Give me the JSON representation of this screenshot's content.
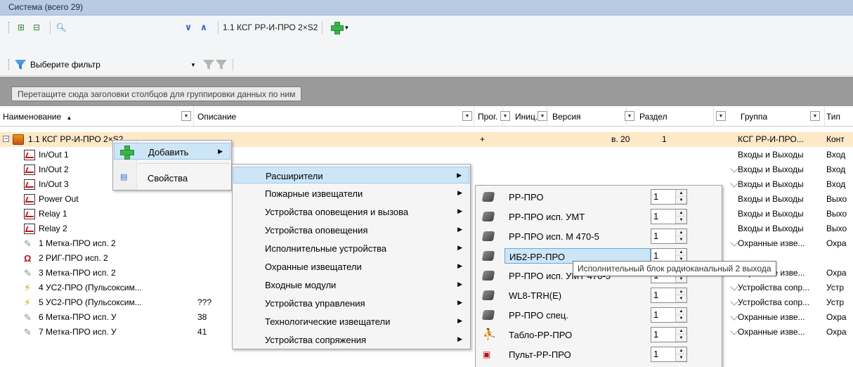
{
  "title": "Система (всего 29)",
  "toolbar": {
    "current_device": "1.1 КСГ РР-И-ПРО 2×S2"
  },
  "filter": {
    "label": "Выберите фильтр"
  },
  "group_hint": "Перетащите сюда заголовки столбцов для группировки данных по ним",
  "columns": {
    "name": "Наименование",
    "sort": "▲",
    "description": "Описание",
    "prog": "Прог.",
    "init": "Иниц.",
    "version": "Версия",
    "section": "Раздел",
    "group": "Группа",
    "type": "Тип"
  },
  "rows": [
    {
      "name": "1.1 КСГ РР-И-ПРО 2×S2",
      "desc": "",
      "prog": "+",
      "version": "в. 20",
      "section": "1",
      "group": "КСГ РР-И-ПРО...",
      "type": "Конт",
      "icon": "device-icon",
      "selected": true
    },
    {
      "name": "In/Out 1",
      "desc": "",
      "group": "Входы и Выходы",
      "type": "Вход",
      "icon": "io-icon"
    },
    {
      "name": "In/Out 2",
      "desc": "",
      "group": "Входы и Выходы",
      "type": "Вход",
      "icon": "io-icon"
    },
    {
      "name": "In/Out 3",
      "desc": "",
      "group": "Входы и Выходы",
      "type": "Вход",
      "icon": "io-icon"
    },
    {
      "name": "Power Out",
      "desc": "",
      "group": "Входы и Выходы",
      "type": "Выхо",
      "icon": "io-icon"
    },
    {
      "name": "Relay 1",
      "desc": "",
      "group": "Входы и Выходы",
      "type": "Выхо",
      "icon": "io-icon"
    },
    {
      "name": "Relay 2",
      "desc": "",
      "group": "Входы и Выходы",
      "type": "Выхо",
      "icon": "io-icon"
    },
    {
      "name": "1 Метка-ПРО исп. 2",
      "desc": "",
      "group": "Охранные изве...",
      "type": "Охра",
      "icon": "tag-icon"
    },
    {
      "name": "2 РИГ-ПРО исп. 2",
      "desc": "",
      "group": "",
      "type": "",
      "icon": "magnet-icon"
    },
    {
      "name": "3 Метка-ПРО исп. 2",
      "desc": "",
      "group": "Охранные изве...",
      "type": "Охра",
      "icon": "tag-icon"
    },
    {
      "name": "4 УС2-ПРО (Пульсоксим...",
      "desc": "",
      "group": "Устройства сопр...",
      "type": "Устр",
      "icon": "bolt-icon"
    },
    {
      "name": "5 УС2-ПРО (Пульсоксим...",
      "desc": "???",
      "group": "Устройства сопр...",
      "type": "Устр",
      "icon": "bolt-icon"
    },
    {
      "name": "6 Метка-ПРО исп. У",
      "desc": "38",
      "group": "Охранные изве...",
      "type": "Охра",
      "icon": "tag-icon"
    },
    {
      "name": "7 Метка-ПРО исп. У",
      "desc": "41",
      "group": "Охранные изве...",
      "type": "Охра",
      "icon": "tag-icon"
    }
  ],
  "context_menu": {
    "items": [
      {
        "label": "Добавить",
        "icon": "plus-icon",
        "has_submenu": true,
        "highlighted": true
      },
      {
        "label": "Свойства",
        "icon": "properties-icon",
        "has_submenu": false
      }
    ]
  },
  "submenu": {
    "items": [
      {
        "label": "Расширители",
        "highlighted": true
      },
      {
        "label": "Пожарные извещатели"
      },
      {
        "label": "Устройства оповещения и вызова"
      },
      {
        "label": "Устройства оповещения"
      },
      {
        "label": "Исполнительные устройства"
      },
      {
        "label": "Охранные извещатели"
      },
      {
        "label": "Входные модули"
      },
      {
        "label": "Устройства управления"
      },
      {
        "label": "Технологические извещатели"
      },
      {
        "label": "Устройства сопряжения"
      }
    ]
  },
  "expanders_menu": {
    "items": [
      {
        "label": "РР-ПРО",
        "qty": "1",
        "icon": "expander-icon"
      },
      {
        "label": "РР-ПРО исп. УМТ",
        "qty": "1",
        "icon": "expander-icon"
      },
      {
        "label": "РР-ПРО исп. М 470-5",
        "qty": "1",
        "icon": "expander-icon"
      },
      {
        "label": "ИБ2-РР-ПРО",
        "qty": "1",
        "icon": "expander-icon",
        "highlighted": true
      },
      {
        "label": "РР-ПРО исп. УМТ 470-5",
        "qty": "1",
        "icon": "expander-icon"
      },
      {
        "label": "WL8-TRH(E)",
        "qty": "1",
        "icon": "expander-icon"
      },
      {
        "label": "РР-ПРО спец.",
        "qty": "1",
        "icon": "expander-icon"
      },
      {
        "label": "Табло-РР-ПРО",
        "qty": "1",
        "icon": "running-man-icon"
      },
      {
        "label": "Пульт-РР-ПРО",
        "qty": "1",
        "icon": "panel-icon"
      }
    ]
  },
  "tooltip": "Исполнительный блок радиоканальный 2 выхода"
}
